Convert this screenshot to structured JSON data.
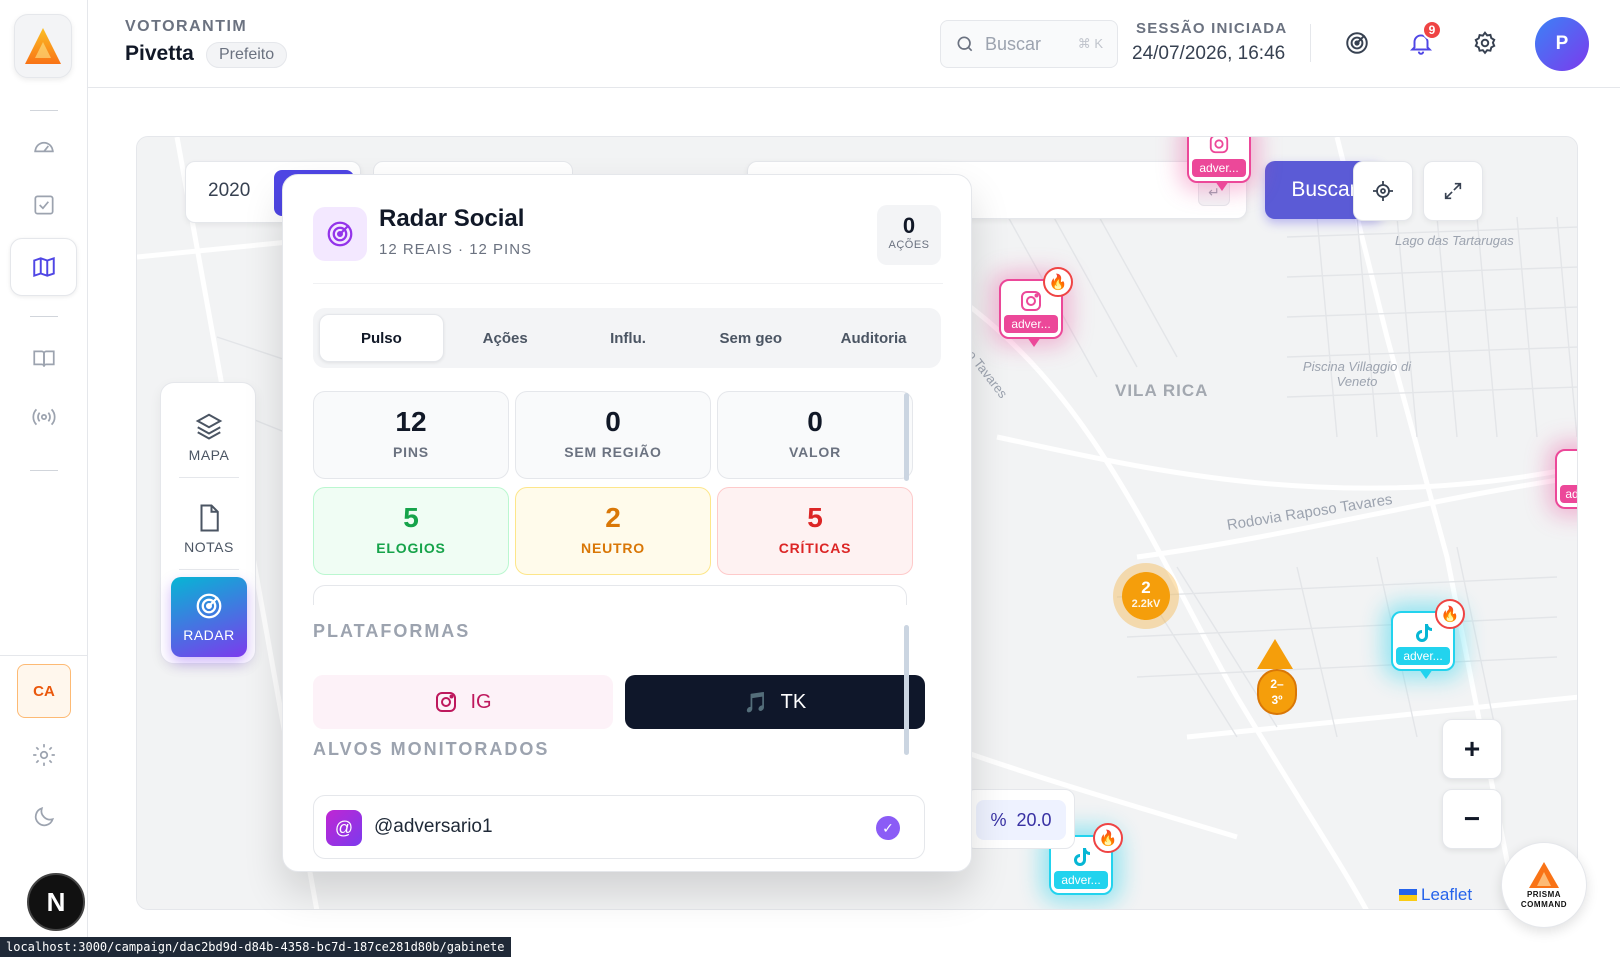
{
  "header": {
    "org": "VOTORANTIM",
    "user_name": "Pivetta",
    "role": "Prefeito",
    "search_placeholder": "Buscar",
    "search_shortcut": "⌘ K",
    "session_label": "SESSÃO INICIADA",
    "session_time": "24/07/2026, 16:46",
    "notification_count": "9",
    "avatar_initial": "P"
  },
  "rail": {
    "items": [
      "gauge-icon",
      "check-square-icon",
      "map-icon",
      "book-icon",
      "broadcast-icon"
    ],
    "active": "map-icon",
    "campaign_badge": "CA",
    "dev_badge": "N"
  },
  "map": {
    "year": "2020",
    "search_button": "Buscar",
    "enter_key": "↵",
    "zoom_in": "+",
    "zoom_out": "−",
    "percent_symbol": "%",
    "percent_value": "20.0",
    "attribution": "Leaflet",
    "labels": {
      "lago": "Lago das Tartarugas",
      "piscina": "Piscina Villaggio di Veneto",
      "bairro": "VILA RICA",
      "rodovia": "Rodovia Raposo Tavares",
      "raposo": "Raposo Tavares"
    },
    "pins": [
      {
        "platform": "instagram",
        "label": "adver...",
        "hot": true
      },
      {
        "platform": "tiktok",
        "label": "adver...",
        "hot": true
      },
      {
        "platform": "tiktok",
        "label": "adver...",
        "hot": true
      },
      {
        "platform": "instagram",
        "label": "adver...",
        "hot": false
      },
      {
        "platform": "instagram",
        "label": "ad",
        "hot": false
      }
    ],
    "cluster": {
      "count": "2",
      "sub": "2.2kV"
    },
    "warning_cluster": {
      "line1": "2–",
      "line2": "3º"
    }
  },
  "tools": [
    {
      "label": "MAPA",
      "icon": "layers-icon"
    },
    {
      "label": "NOTAS",
      "icon": "file-icon"
    },
    {
      "label": "RADAR",
      "icon": "radar-icon"
    }
  ],
  "panel": {
    "title": "Radar Social",
    "subtitle": "12 REAIS · 12 PINS",
    "actions_count": "0",
    "actions_label": "AÇÕES",
    "tabs": [
      "Pulso",
      "Ações",
      "Influ.",
      "Sem geo",
      "Auditoria"
    ],
    "active_tab": "Pulso",
    "stats": [
      {
        "value": "12",
        "label": "PINS"
      },
      {
        "value": "0",
        "label": "SEM REGIÃO"
      },
      {
        "value": "0",
        "label": "VALOR"
      },
      {
        "value": "5",
        "label": "ELOGIOS"
      },
      {
        "value": "2",
        "label": "NEUTRO"
      },
      {
        "value": "5",
        "label": "CRÍTICAS"
      }
    ],
    "platforms_title": "PLATAFORMAS",
    "platforms": [
      {
        "label": "IG",
        "icon": "instagram-icon"
      },
      {
        "label": "TK",
        "icon": "music-note-icon"
      }
    ],
    "targets_title": "ALVOS MONITORADOS",
    "targets": [
      {
        "handle": "@adversario1",
        "symbol": "@",
        "checked": true
      }
    ]
  },
  "status_url": "localhost:3000/campaign/dac2bd9d-d84b-4358-bc7d-187ce281d80b/gabinete",
  "brand": {
    "line1": "PRISMA",
    "line2": "COMMAND"
  },
  "colors": {
    "accent": "#4f46e5",
    "instagram": "#ec4899",
    "tiktok": "#22d3ee",
    "positive": "#16a34a",
    "neutral": "#d97706",
    "negative": "#dc2626"
  }
}
